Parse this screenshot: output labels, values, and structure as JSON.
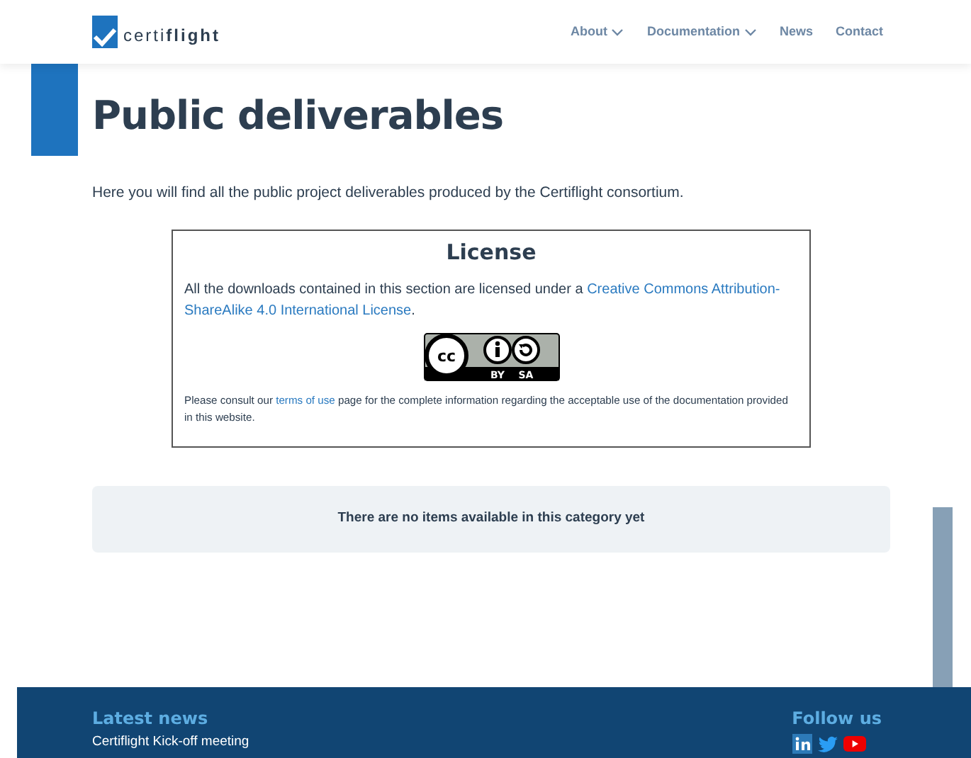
{
  "header": {
    "logo": "certi**flight**",
    "nav": [
      {
        "label": "About",
        "has_menu": true
      },
      {
        "label": "Documentation",
        "has_menu": true
      },
      {
        "label": "News",
        "has_menu": false
      },
      {
        "label": "Contact",
        "has_menu": false
      }
    ]
  },
  "title": "Public deliverables",
  "intro": "Here you will find all the public project deliverables produced by the Certiflight consortium.",
  "license": {
    "heading": "License",
    "text": "All the downloads contained in this section are licensed under a ",
    "link": [
      "Creative Commons Attribution-",
      "ShareAlike 4.0 International License"
    ],
    "after": ".",
    "badge": {
      "logo": "cc",
      "labels": [
        "BY",
        "SA"
      ]
    },
    "note_before": "Please consult our ",
    "note_link": "terms of use",
    "note_after": " page for the complete information regarding the acceptable use of the documentation provided in this website."
  },
  "empty_message": "There are no items available in this category yet",
  "footer": {
    "news_heading": "Latest news",
    "news_items": [
      "Certiflight Kick-off meeting"
    ],
    "follow_heading": "Follow us",
    "social": [
      {
        "kind": "linkedin"
      },
      {
        "kind": "twitter"
      },
      {
        "kind": "youtube"
      }
    ]
  }
}
